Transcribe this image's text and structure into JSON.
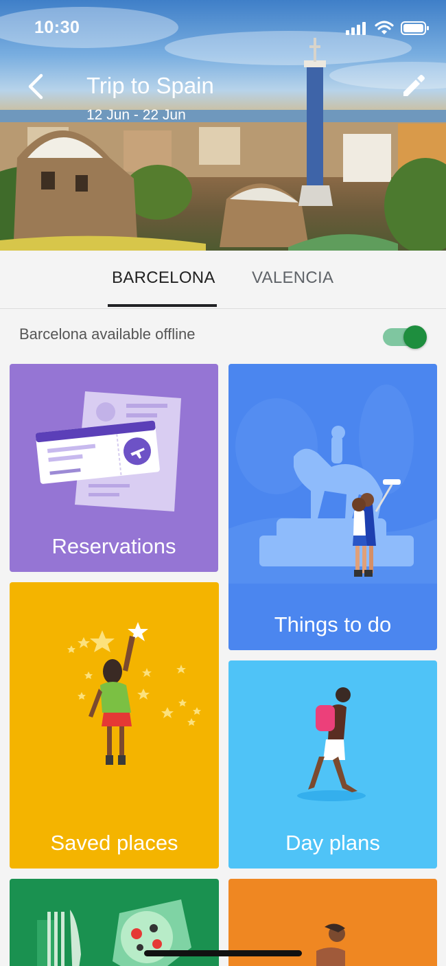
{
  "status": {
    "time": "10:30"
  },
  "header": {
    "title": "Trip to Spain",
    "dates": "12 Jun - 22 Jun"
  },
  "tabs": [
    {
      "label": "BARCELONA",
      "selected": true
    },
    {
      "label": "VALENCIA",
      "selected": false
    }
  ],
  "offline": {
    "label": "Barcelona available offline",
    "enabled": true
  },
  "cards": {
    "reservations": {
      "label": "Reservations",
      "color": "#9575d4"
    },
    "things_to_do": {
      "label": "Things to do",
      "color": "#4b86ef"
    },
    "saved_places": {
      "label": "Saved places",
      "color": "#f4b400"
    },
    "day_plans": {
      "label": "Day plans",
      "color": "#4fc3f7"
    },
    "food": {
      "color": "#1a9150"
    },
    "activities": {
      "color": "#ef8722"
    }
  },
  "icons": [
    "back-arrow-icon",
    "edit-pencil-icon",
    "signal-icon",
    "wifi-icon",
    "battery-icon"
  ]
}
